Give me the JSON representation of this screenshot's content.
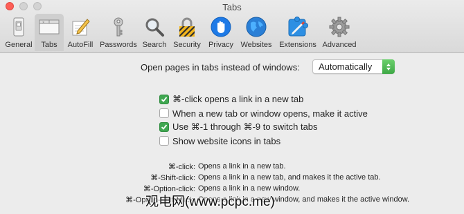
{
  "window": {
    "title": "Tabs"
  },
  "toolbar": {
    "items": [
      {
        "label": "General",
        "icon": "general-switch-icon"
      },
      {
        "label": "Tabs",
        "icon": "tabs-icon",
        "selected": true
      },
      {
        "label": "AutoFill",
        "icon": "autofill-pencil-icon"
      },
      {
        "label": "Passwords",
        "icon": "key-icon"
      },
      {
        "label": "Search",
        "icon": "magnifier-icon"
      },
      {
        "label": "Security",
        "icon": "padlock-icon"
      },
      {
        "label": "Privacy",
        "icon": "hand-icon"
      },
      {
        "label": "Websites",
        "icon": "globe-icon"
      },
      {
        "label": "Extensions",
        "icon": "extensions-puzzle-icon"
      },
      {
        "label": "Advanced",
        "icon": "gear-icon"
      }
    ]
  },
  "open_pages": {
    "label": "Open pages in tabs instead of windows:",
    "selected": "Automatically"
  },
  "checkboxes": [
    {
      "label": "⌘-click opens a link in a new tab",
      "checked": true
    },
    {
      "label": "When a new tab or window opens, make it active",
      "checked": false
    },
    {
      "label": "Use ⌘-1 through ⌘-9 to switch tabs",
      "checked": true
    },
    {
      "label": "Show website icons in tabs",
      "checked": false
    }
  ],
  "shortcuts": [
    {
      "key": "⌘-click:",
      "desc": "Opens a link in a new tab."
    },
    {
      "key": "⌘-Shift-click:",
      "desc": "Opens a link in a new tab, and makes it the active tab."
    },
    {
      "key": "⌘-Option-click:",
      "desc": "Opens a link in a new window."
    },
    {
      "key": "⌘-Option-Shift-click:",
      "desc": "Opens a link in a new window, and makes it the active window."
    }
  ],
  "watermark": "观电网(www.pcpc.me)",
  "colors": {
    "accent_green": "#3fa650",
    "close_red": "#fd5f57"
  }
}
